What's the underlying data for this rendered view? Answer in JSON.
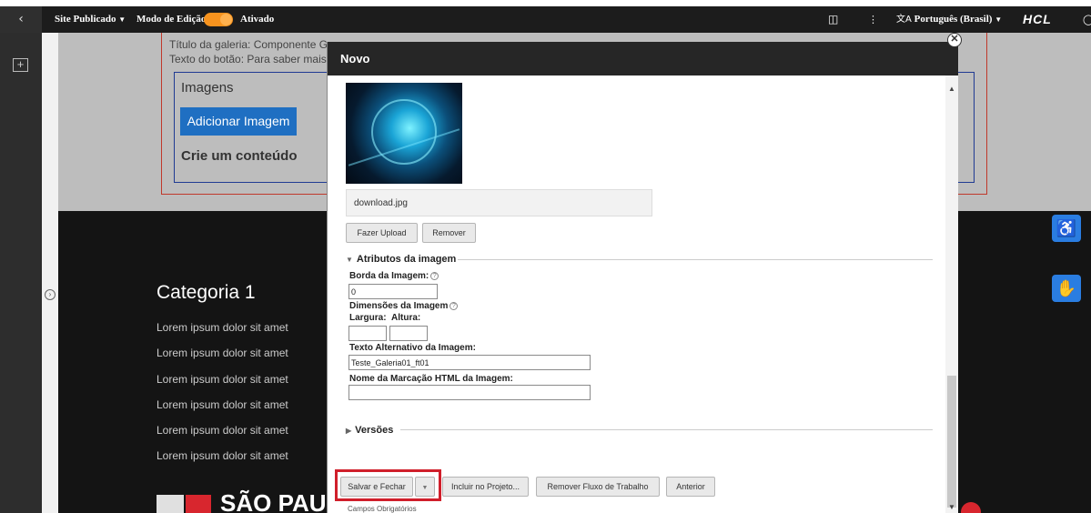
{
  "topbar": {
    "back_icon": "chevron-left-icon",
    "site_label": "Site Publicado",
    "edit_mode_label": "Modo de Edição:",
    "edit_mode_value": "Ativado",
    "language": "Português (Brasil)",
    "brand": "HCL",
    "accent_color": "#f7931e"
  },
  "background": {
    "gallery_title_line": "Título da galeria: Componente Ga",
    "button_text_line": "Texto do botão: Para saber mais, c",
    "images_label": "Imagens",
    "add_image_button": "Adicionar Imagem",
    "create_content": "Crie um conteúdo",
    "category_title": "Categoria 1",
    "lorem_items": [
      "Lorem ipsum dolor sit amet",
      "Lorem ipsum dolor sit amet",
      "Lorem ipsum dolor sit amet",
      "Lorem ipsum dolor sit amet",
      "Lorem ipsum dolor sit amet",
      "Lorem ipsum dolor sit amet"
    ],
    "logo_text": "SÃO PAU"
  },
  "modal": {
    "title": "Novo",
    "file_name": "download.jpg",
    "upload_button": "Fazer Upload",
    "remove_button": "Remover",
    "attributes_section": "Atributos da imagem",
    "border_label": "Borda da Imagem:",
    "border_value": "0",
    "dimensions_label": "Dimensões da Imagem",
    "width_label": "Largura:",
    "height_label": "Altura:",
    "width_value": "",
    "height_value": "",
    "alt_text_label": "Texto Alternativo da Imagem:",
    "alt_text_value": "Teste_Galeria01_ft01",
    "html_tag_label": "Nome da Marcação HTML da Imagem:",
    "html_tag_value": "",
    "versions_section": "Versões",
    "save_close_button": "Salvar e Fechar",
    "include_project_button": "Incluir no Projeto...",
    "remove_workflow_button": "Remover Fluxo de Trabalho",
    "previous_button": "Anterior",
    "required_fields": "Campos Obrigatórios"
  }
}
